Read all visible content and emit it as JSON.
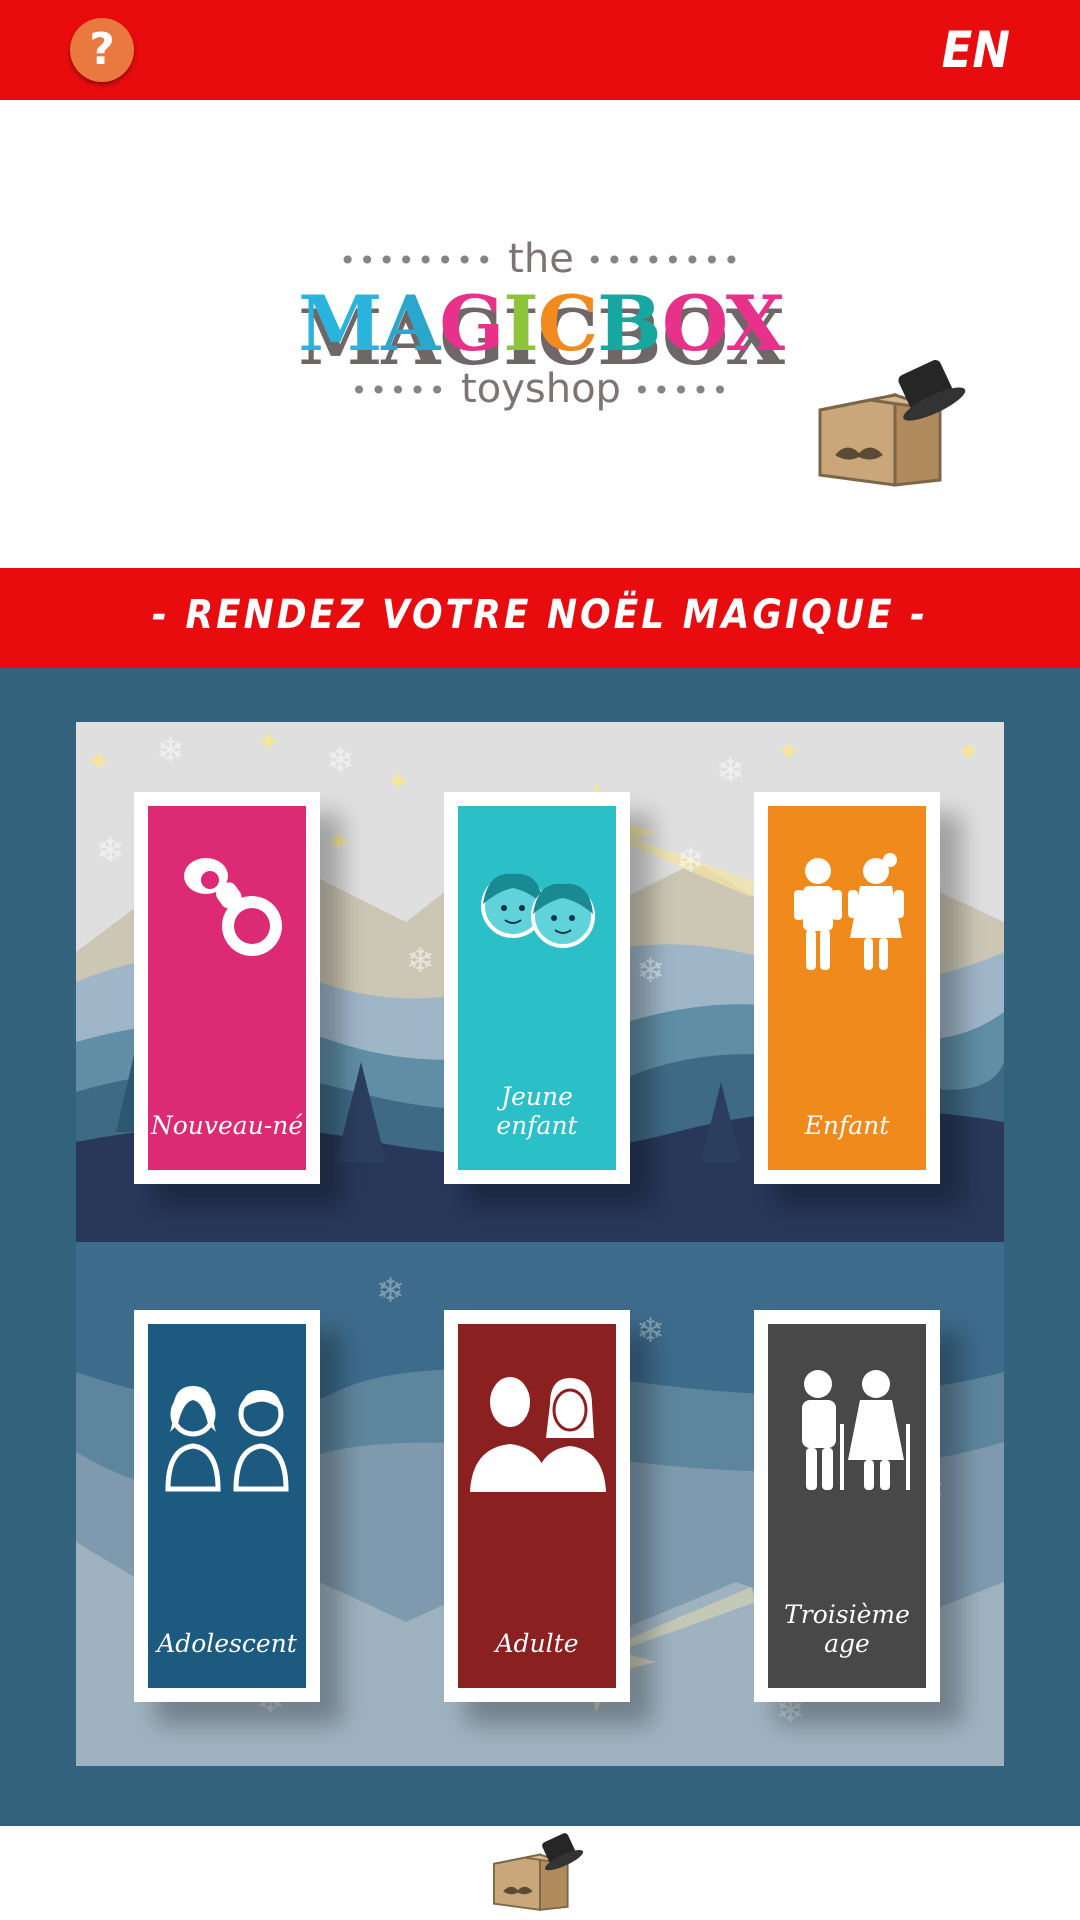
{
  "topbar": {
    "help_label": "?",
    "lang_label": "EN"
  },
  "logo": {
    "the": "the",
    "name": [
      "M",
      "A",
      "G",
      "I",
      "C",
      "B",
      "O",
      "X"
    ],
    "name_colors": [
      "#2ab3dd",
      "#2aa7cc",
      "#e8318a",
      "#8cc43a",
      "#f28a1e",
      "#17a7a0",
      "#e8318a",
      "#e8318a"
    ],
    "shop": "toyshop",
    "dots": "••••••••"
  },
  "banner": {
    "text": "- RENDEZ VOTRE NOËL MAGIQUE -"
  },
  "categories": [
    {
      "label": "Nouveau-né",
      "color": "#dc2a74",
      "icon": "pacifier-icon"
    },
    {
      "label": "Jeune enfant",
      "color": "#2bbfc8",
      "icon": "kids-faces-icon"
    },
    {
      "label": "Enfant",
      "color": "#f08a1d",
      "icon": "children-icon"
    },
    {
      "label": "Adolescent",
      "color": "#1d5a80",
      "icon": "teens-icon"
    },
    {
      "label": "Adulte",
      "color": "#8b2020",
      "icon": "adults-icon"
    },
    {
      "label": "Troisième age",
      "color": "#484848",
      "icon": "seniors-icon"
    }
  ]
}
